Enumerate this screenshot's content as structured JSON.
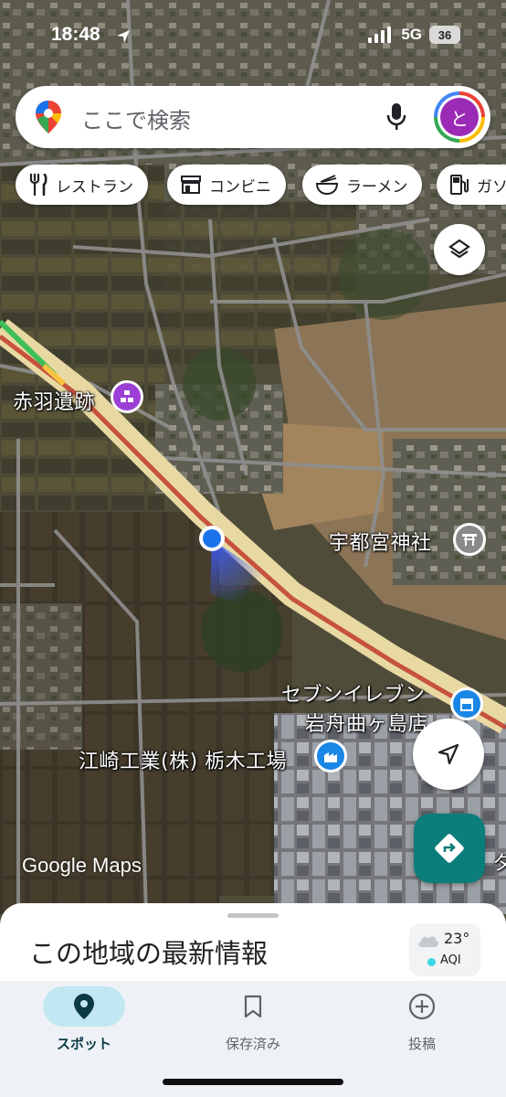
{
  "status_bar": {
    "time": "18:48",
    "network": "5G",
    "battery": "36"
  },
  "search": {
    "placeholder": "ここで検索",
    "avatar_initial": "と"
  },
  "chips": [
    {
      "label": "レストラン",
      "icon": "fork-knife-icon"
    },
    {
      "label": "コンビニ",
      "icon": "store-icon"
    },
    {
      "label": "ラーメン",
      "icon": "ramen-bowl-icon"
    },
    {
      "label": "ガソ",
      "icon": "gas-pump-icon"
    }
  ],
  "map": {
    "places": [
      {
        "name": "赤羽遺跡",
        "icon": "landmark-icon",
        "color": "#9c3fd6"
      },
      {
        "name": "宇都宮神社",
        "icon": "shrine-icon",
        "color": "#8a8a8a"
      },
      {
        "name": "セブンイレブン",
        "name_line2": "岩舟曲ヶ島店",
        "icon": "convenience-store-icon",
        "color": "#1a87e6"
      },
      {
        "name": "江崎工業(株) 栃木工場",
        "icon": "factory-icon",
        "color": "#1a87e6"
      }
    ],
    "edge_label": "ダ",
    "watermark": "Google Maps",
    "location_dot_color": "#1a73e8"
  },
  "sheet": {
    "title": "この地域の最新情報",
    "weather": {
      "temp": "23°",
      "aqi": "AQI"
    }
  },
  "bottom_nav": [
    {
      "label": "スポット",
      "icon": "location-pin-icon",
      "active": true
    },
    {
      "label": "保存済み",
      "icon": "bookmark-icon",
      "active": false
    },
    {
      "label": "投稿",
      "icon": "add-circle-icon",
      "active": false
    }
  ],
  "colors": {
    "accent": "#0b7d7a",
    "nav_active_bg": "#c2e7f2",
    "sheet_bg": "#ffffff"
  }
}
